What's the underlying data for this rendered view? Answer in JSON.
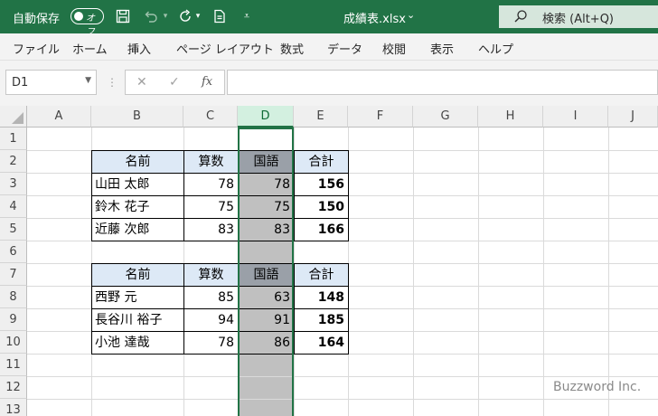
{
  "titlebar": {
    "autosave_label": "自動保存",
    "toggle_text": "オフ",
    "filename": "成績表.xlsx",
    "search_label": "検索 (Alt+Q)"
  },
  "ribbon": {
    "tabs": [
      "ファイル",
      "ホーム",
      "挿入",
      "ページ レイアウト",
      "数式",
      "データ",
      "校閲",
      "表示",
      "ヘルプ"
    ]
  },
  "formula_bar": {
    "name_box": "D1",
    "fx": "fx",
    "cancel": "✕",
    "enter": "✓",
    "value": ""
  },
  "grid": {
    "columns": [
      "A",
      "B",
      "C",
      "D",
      "E",
      "F",
      "G",
      "H",
      "I",
      "J"
    ],
    "rows": [
      "1",
      "2",
      "3",
      "4",
      "5",
      "6",
      "7",
      "8",
      "9",
      "10",
      "11",
      "12",
      "13"
    ],
    "selected_column": "D"
  },
  "table1": {
    "headers": [
      "名前",
      "算数",
      "国語",
      "合計"
    ],
    "rows": [
      [
        "山田 太郎",
        "78",
        "78",
        "156"
      ],
      [
        "鈴木 花子",
        "75",
        "75",
        "150"
      ],
      [
        "近藤 次郎",
        "83",
        "83",
        "166"
      ]
    ]
  },
  "table2": {
    "headers": [
      "名前",
      "算数",
      "国語",
      "合計"
    ],
    "rows": [
      [
        "西野 元",
        "85",
        "63",
        "148"
      ],
      [
        "長谷川 裕子",
        "94",
        "91",
        "185"
      ],
      [
        "小池 達哉",
        "78",
        "86",
        "164"
      ]
    ]
  },
  "watermark": "Buzzword Inc.",
  "colors": {
    "excel_green": "#217346",
    "table_header_fill": "#dde9f6",
    "selected_column_fill": "#c0c0c0"
  }
}
